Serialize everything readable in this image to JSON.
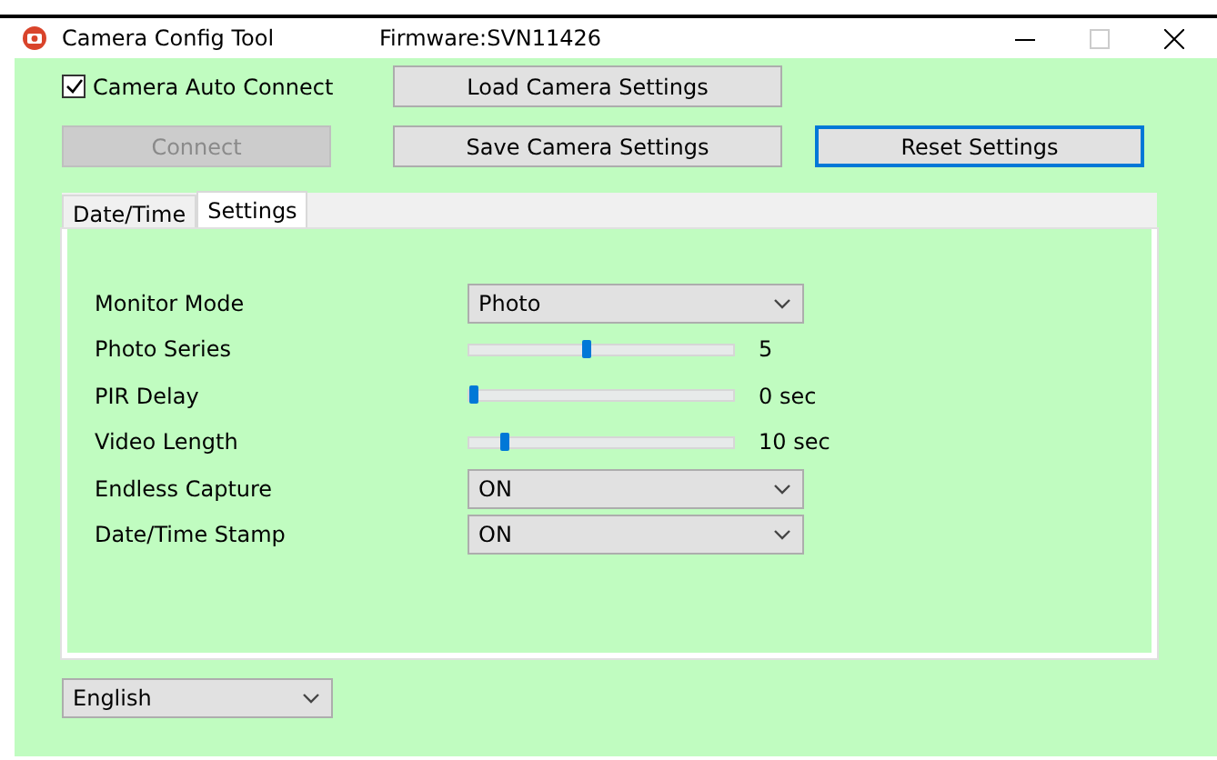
{
  "window": {
    "title": "Camera Config Tool",
    "firmware": "Firmware:SVN11426"
  },
  "auto_connect": {
    "label": "Camera Auto Connect",
    "checked": true
  },
  "buttons": [
    {
      "label": "Load Camera Settings",
      "disabled": false,
      "focused": false
    },
    {
      "label": "Connect",
      "disabled": true,
      "focused": false
    },
    {
      "label": "Save Camera Settings",
      "disabled": false,
      "focused": false
    },
    {
      "label": "Reset Settings",
      "disabled": false,
      "focused": true
    }
  ],
  "tabs": [
    {
      "label": "Date/Time",
      "selected": false
    },
    {
      "label": "Settings",
      "selected": true
    }
  ],
  "settings": [
    {
      "kind": "select",
      "label": "Monitor Mode",
      "value": "Photo"
    },
    {
      "kind": "slider",
      "label": "Photo Series",
      "level": 0.44,
      "reading": "5"
    },
    {
      "kind": "slider",
      "label": "PIR Delay",
      "level": 0,
      "reading": "0 sec"
    },
    {
      "kind": "slider",
      "label": "Video Length",
      "level": 0.12,
      "reading": "10 sec"
    },
    {
      "kind": "select",
      "label": "Endless Capture",
      "value": "ON"
    },
    {
      "kind": "select",
      "label": "Date/Time Stamp",
      "value": "ON"
    }
  ],
  "language": {
    "value": "English"
  }
}
